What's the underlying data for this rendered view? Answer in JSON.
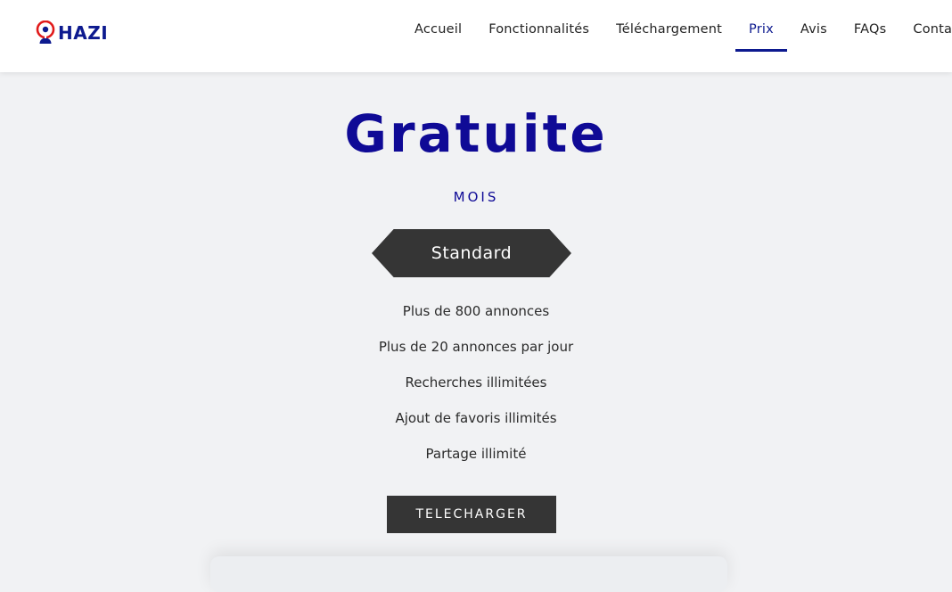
{
  "brand": {
    "name": "HAZI",
    "colors": {
      "primary": "#0d1a8f",
      "accent": "#e11a1a"
    },
    "logo_icon": "person-pin-icon"
  },
  "nav": {
    "items": [
      {
        "label": "Accueil",
        "active": false
      },
      {
        "label": "Fonctionnalités",
        "active": false
      },
      {
        "label": "Téléchargement",
        "active": false
      },
      {
        "label": "Prix",
        "active": true
      },
      {
        "label": "Avis",
        "active": false
      },
      {
        "label": "FAQs",
        "active": false
      },
      {
        "label": "Contact",
        "active": false
      }
    ]
  },
  "pricing": {
    "price": "Gratuite",
    "period": "MOIS",
    "plan": "Standard",
    "features": [
      "Plus de 800 annonces",
      "Plus de 20 annonces par jour",
      "Recherches illimitées",
      "Ajout de favoris illimités",
      "Partage illimité"
    ],
    "cta": "TELECHARGER"
  }
}
